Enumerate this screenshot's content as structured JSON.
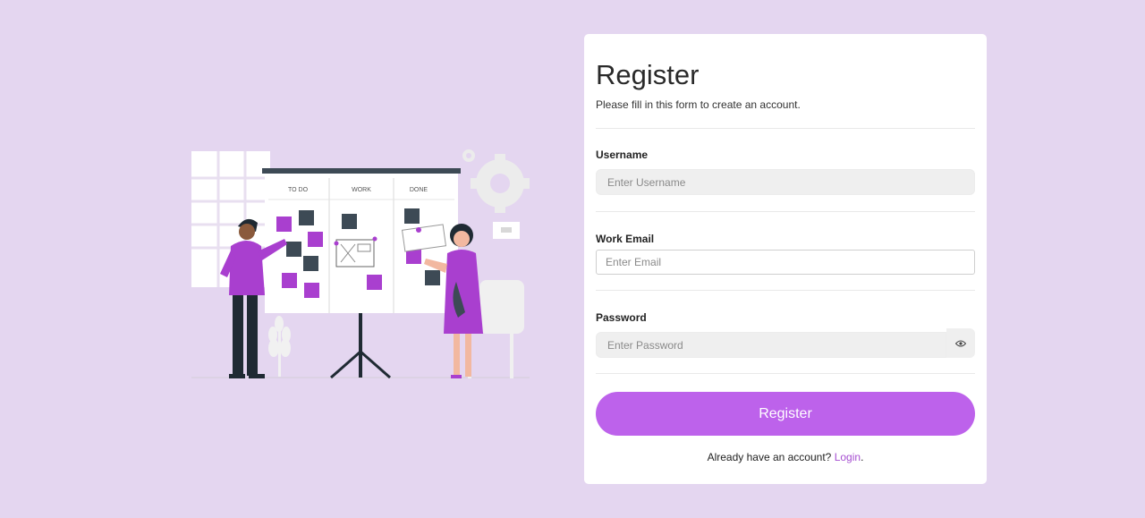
{
  "form": {
    "title": "Register",
    "subtitle": "Please fill in this form to create an account.",
    "username": {
      "label": "Username",
      "placeholder": "Enter Username",
      "value": ""
    },
    "email": {
      "label": "Work Email",
      "placeholder": "Enter Email",
      "value": ""
    },
    "password": {
      "label": "Password",
      "placeholder": "Enter Password",
      "value": "",
      "toggle_icon": "eye-icon"
    },
    "submit_label": "Register",
    "login_prompt": "Already have an account?",
    "login_link": "Login"
  },
  "illustration": {
    "board_columns": [
      "TO DO",
      "WORK",
      "DONE"
    ]
  },
  "colors": {
    "background": "#e4d6f0",
    "accent": "#bd62eb",
    "link": "#a64fd1",
    "sticky_purple": "#a93fcf",
    "sticky_dark": "#3d4a55"
  }
}
